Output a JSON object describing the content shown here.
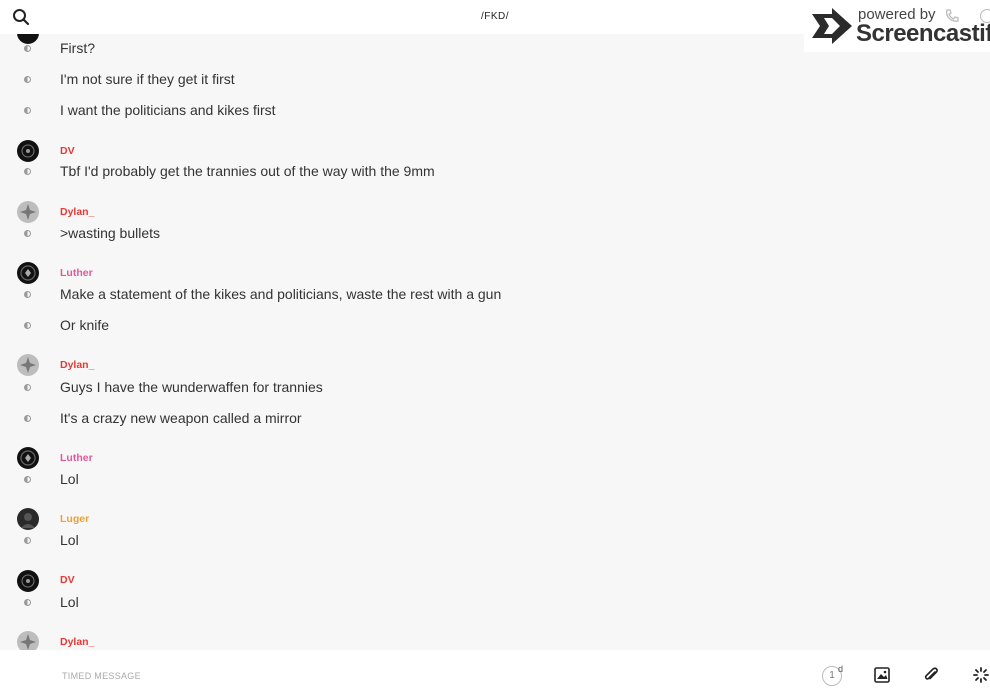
{
  "header": {
    "channel_title": "/FKD/"
  },
  "watermark": {
    "powered": "powered by",
    "brand": "Screencastify"
  },
  "authors": {
    "dv": {
      "name": "DV",
      "color": "#e53935"
    },
    "dylan": {
      "name": "Dylan_",
      "color": "#e53935"
    },
    "luther": {
      "name": "Luther",
      "color": "#e05a9a"
    },
    "luger": {
      "name": "Luger",
      "color": "#f0a030"
    }
  },
  "messages": [
    {
      "text": "First?"
    },
    {
      "text": "I'm not sure if they get it first"
    },
    {
      "text": "I want the politicians and kikes first"
    },
    {
      "author": "DV",
      "text": "Tbf I'd probably get the trannies out of the way with the 9mm"
    },
    {
      "author": "Dylan_",
      "text": ">wasting bullets"
    },
    {
      "author": "Luther",
      "text": "Make a statement of the kikes and politicians, waste the rest with a gun"
    },
    {
      "text": "Or knife"
    },
    {
      "author": "Dylan_",
      "text": "Guys I have the wunderwaffen for trannies"
    },
    {
      "text": "It's a crazy new weapon called a mirror"
    },
    {
      "author": "Luther",
      "text": "Lol"
    },
    {
      "author": "Luger",
      "text": "Lol"
    },
    {
      "author": "DV",
      "text": "Lol"
    },
    {
      "author": "Dylan_"
    }
  ],
  "composer": {
    "placeholder": "TIMED MESSAGE",
    "timer_value": "1",
    "timer_unit": "d"
  }
}
